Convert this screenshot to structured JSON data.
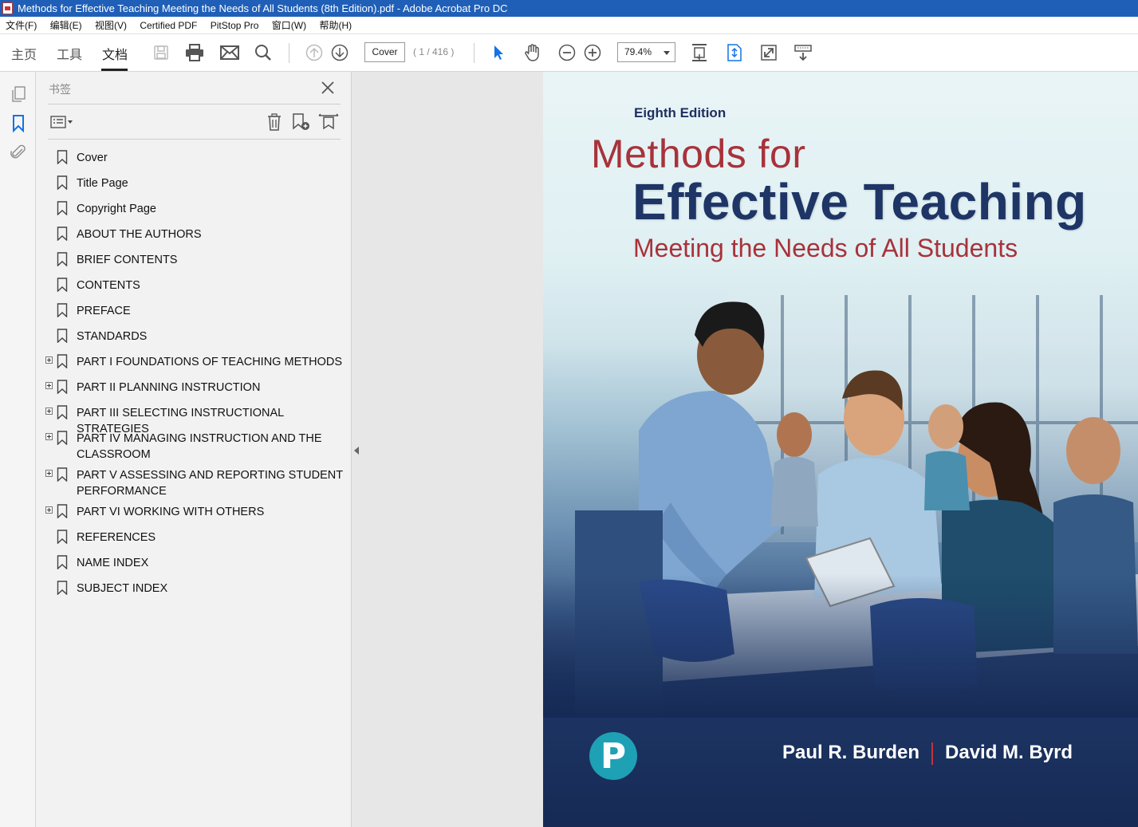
{
  "window": {
    "title": "Methods for Effective Teaching Meeting the Needs of All Students (8th Edition).pdf - Adobe Acrobat Pro DC"
  },
  "menu": [
    "文件(F)",
    "编辑(E)",
    "视图(V)",
    "Certified PDF",
    "PitStop Pro",
    "窗口(W)",
    "帮助(H)"
  ],
  "toolbar": {
    "tabs": [
      "主页",
      "工具",
      "文档"
    ],
    "active_tab": "文档",
    "page_label": "Cover",
    "page_count": "( 1 / 416 )",
    "zoom": "79.4%"
  },
  "bookmarks_panel": {
    "title": "书签",
    "items": [
      {
        "label": "Cover",
        "expandable": false
      },
      {
        "label": "Title Page",
        "expandable": false
      },
      {
        "label": "Copyright Page",
        "expandable": false
      },
      {
        "label": "ABOUT THE AUTHORS",
        "expandable": false
      },
      {
        "label": "BRIEF CONTENTS",
        "expandable": false
      },
      {
        "label": "CONTENTS",
        "expandable": false
      },
      {
        "label": "PREFACE",
        "expandable": false
      },
      {
        "label": "STANDARDS",
        "expandable": false
      },
      {
        "label": "PART I FOUNDATIONS OF TEACHING METHODS",
        "expandable": true
      },
      {
        "label": "PART II PLANNING INSTRUCTION",
        "expandable": true
      },
      {
        "label": "PART III SELECTING INSTRUCTIONAL STRATEGIES",
        "expandable": true
      },
      {
        "label": "PART IV MANAGING INSTRUCTION AND THE CLASSROOM",
        "expandable": true
      },
      {
        "label": "PART V ASSESSING AND REPORTING STUDENT PERFORMANCE",
        "expandable": true
      },
      {
        "label": "PART VI WORKING WITH OTHERS",
        "expandable": true
      },
      {
        "label": "REFERENCES",
        "expandable": false
      },
      {
        "label": "NAME INDEX",
        "expandable": false
      },
      {
        "label": "SUBJECT INDEX",
        "expandable": false
      }
    ]
  },
  "cover": {
    "edition": "Eighth Edition",
    "title_line1": "Methods for",
    "title_line2": "Effective Teaching",
    "subtitle": "Meeting the Needs of All Students",
    "author1": "Paul R. Burden",
    "author2": "David M. Byrd",
    "publisher_logo": "P"
  }
}
